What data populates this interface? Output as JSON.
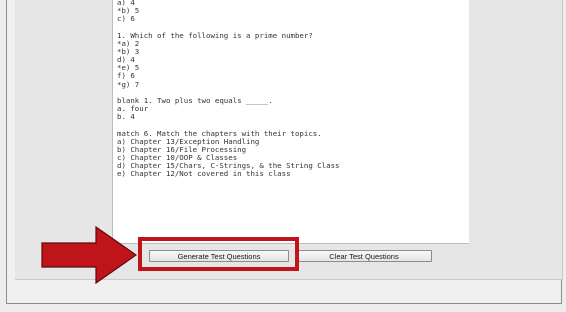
{
  "output": {
    "text_lines": [
      "a) 4",
      "*b) 5",
      "c) 6",
      "",
      "1. Which of the following is a prime number?",
      "*a) 2",
      "*b) 3",
      "d) 4",
      "*e) 5",
      "f) 6",
      "*g) 7",
      "",
      "blank 1. Two plus two equals _____.",
      "a. four",
      "b. 4",
      "",
      "match 6. Match the chapters with their topics.",
      "a) Chapter 13/Exception Handling",
      "b) Chapter 16/File Processing",
      "c) Chapter 10/OOP & Classes",
      "d) Chapter 15/Chars, C-Strings, & the String Class",
      "e) Chapter 12/Not covered in this class"
    ]
  },
  "buttons": {
    "generate_label": "Generate Test Questions",
    "clear_label": "Clear Test Questions"
  },
  "annotation": {
    "highlight_color": "#c0141b",
    "arrow_color": "#c0141b"
  }
}
